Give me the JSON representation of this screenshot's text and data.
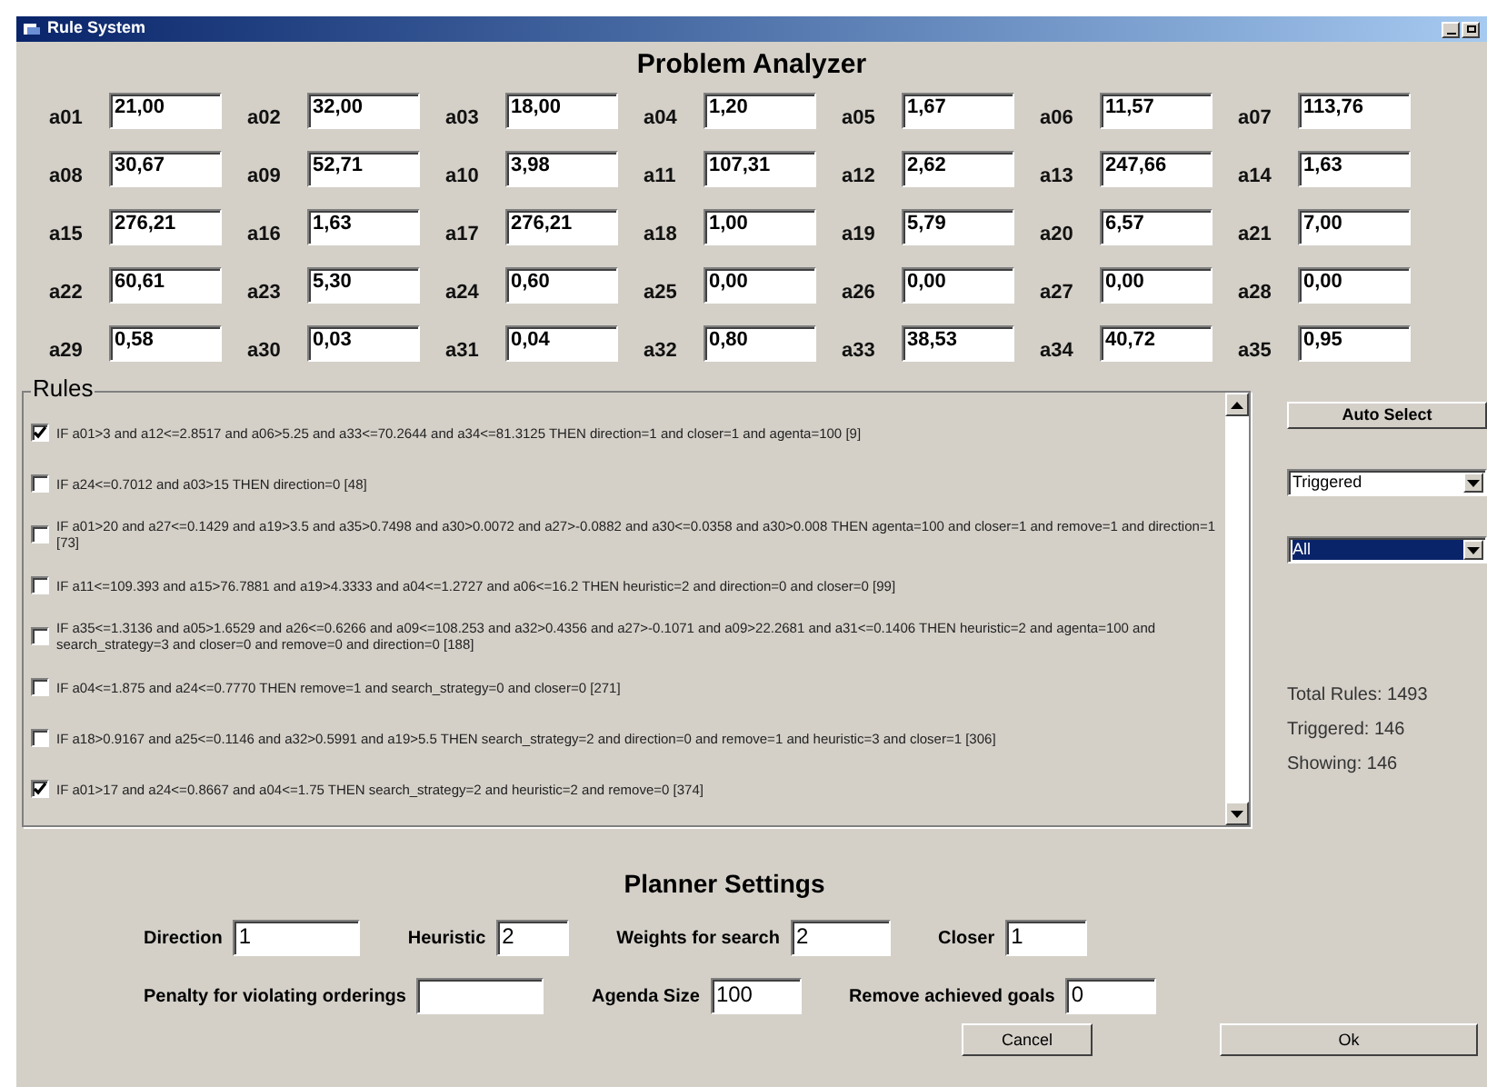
{
  "window": {
    "title": "Rule System"
  },
  "analyzer": {
    "title": "Problem Analyzer",
    "attributes": [
      {
        "label": "a01",
        "value": "21,00"
      },
      {
        "label": "a02",
        "value": "32,00"
      },
      {
        "label": "a03",
        "value": "18,00"
      },
      {
        "label": "a04",
        "value": "1,20"
      },
      {
        "label": "a05",
        "value": "1,67"
      },
      {
        "label": "a06",
        "value": "11,57"
      },
      {
        "label": "a07",
        "value": "113,76"
      },
      {
        "label": "a08",
        "value": "30,67"
      },
      {
        "label": "a09",
        "value": "52,71"
      },
      {
        "label": "a10",
        "value": "3,98"
      },
      {
        "label": "a11",
        "value": "107,31"
      },
      {
        "label": "a12",
        "value": "2,62"
      },
      {
        "label": "a13",
        "value": "247,66"
      },
      {
        "label": "a14",
        "value": "1,63"
      },
      {
        "label": "a15",
        "value": "276,21"
      },
      {
        "label": "a16",
        "value": "1,63"
      },
      {
        "label": "a17",
        "value": "276,21"
      },
      {
        "label": "a18",
        "value": "1,00"
      },
      {
        "label": "a19",
        "value": "5,79"
      },
      {
        "label": "a20",
        "value": "6,57"
      },
      {
        "label": "a21",
        "value": "7,00"
      },
      {
        "label": "a22",
        "value": "60,61"
      },
      {
        "label": "a23",
        "value": "5,30"
      },
      {
        "label": "a24",
        "value": "0,60"
      },
      {
        "label": "a25",
        "value": "0,00"
      },
      {
        "label": "a26",
        "value": "0,00"
      },
      {
        "label": "a27",
        "value": "0,00"
      },
      {
        "label": "a28",
        "value": "0,00"
      },
      {
        "label": "a29",
        "value": "0,58"
      },
      {
        "label": "a30",
        "value": "0,03"
      },
      {
        "label": "a31",
        "value": "0,04"
      },
      {
        "label": "a32",
        "value": "0,80"
      },
      {
        "label": "a33",
        "value": "38,53"
      },
      {
        "label": "a34",
        "value": "40,72"
      },
      {
        "label": "a35",
        "value": "0,95"
      }
    ]
  },
  "rules": {
    "title": "Rules",
    "items": [
      {
        "text": "IF a01>3 and a12<=2.8517 and a06>5.25 and a33<=70.2644 and a34<=81.3125 THEN direction=1 and closer=1 and agenta=100 [9]",
        "checked": true
      },
      {
        "text": "IF a24<=0.7012 and a03>15 THEN direction=0 [48]",
        "checked": false
      },
      {
        "text": "IF a01>20 and a27<=0.1429 and a19>3.5 and a35>0.7498 and a30>0.0072 and a27>-0.0882 and a30<=0.0358 and a30>0.008 THEN agenta=100 and closer=1 and remove=1 and direction=1 [73]",
        "checked": false
      },
      {
        "text": "IF a11<=109.393 and a15>76.7881 and a19>4.3333 and a04<=1.2727 and a06<=16.2 THEN heuristic=2 and direction=0 and closer=0 [99]",
        "checked": false
      },
      {
        "text": "IF a35<=1.3136 and a05>1.6529 and a26<=0.6266 and a09<=108.253 and a32>0.4356 and a27>-0.1071 and a09>22.2681 and a31<=0.1406 THEN heuristic=2 and agenta=100 and search_strategy=3 and closer=0 and remove=0 and direction=0 [188]",
        "checked": false
      },
      {
        "text": "IF a04<=1.875 and a24<=0.7770 THEN remove=1 and search_strategy=0 and closer=0 [271]",
        "checked": false
      },
      {
        "text": "IF a18>0.9167 and a25<=0.1146 and a32>0.5991 and a19>5.5 THEN search_strategy=2 and direction=0 and remove=1 and heuristic=3 and closer=1 [306]",
        "checked": false
      },
      {
        "text": "IF a01>17 and a24<=0.8667 and a04<=1.75 THEN search_strategy=2 and heuristic=2 and remove=0 [374]",
        "checked": true
      }
    ]
  },
  "side": {
    "auto_select": "Auto Select",
    "dropdowns": [
      {
        "value": "Triggered",
        "highlighted": false
      },
      {
        "value": "All",
        "highlighted": true
      }
    ],
    "stats": [
      "Total Rules: 1493",
      "Triggered: 146",
      "Showing: 146"
    ]
  },
  "planner": {
    "title": "Planner Settings",
    "first_line": [
      {
        "label": "Direction",
        "value": "1"
      },
      {
        "label": "Heuristic",
        "value": "2"
      },
      {
        "label": "Weights for search",
        "value": "2"
      },
      {
        "label": "Closer",
        "value": "1"
      }
    ],
    "second_line": [
      {
        "label": "Penalty for violating orderings"
      },
      {
        "label": "Agenda Size",
        "value": "100"
      },
      {
        "label": "Remove achieved goals",
        "value": "0"
      }
    ]
  },
  "buttons": [
    "Cancel",
    "Ok"
  ]
}
